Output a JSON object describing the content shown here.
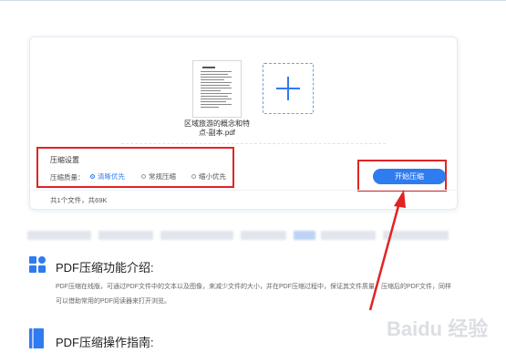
{
  "file": {
    "name": "区域旅游的概念和特点-副本.pdf"
  },
  "settings": {
    "title": "压缩设置",
    "quality_label": "压缩质量：",
    "options": [
      "清晰优先",
      "常规压缩",
      "缩小优先"
    ],
    "selected": "清晰优先"
  },
  "start_button": "开始压缩",
  "file_count": "共1个文件，共69K",
  "sections": [
    {
      "title": "PDF压缩功能介绍:",
      "body": "PDF压缩在线版，可通过PDF文件中的文本以及图像，来减少文件的大小，并在PDF压缩过程中，保证其文件质量。压缩后的PDF文件，同样可以借助常用的PDF阅读器来打开浏览。"
    },
    {
      "title": "PDF压缩操作指南:"
    }
  ],
  "colors": {
    "accent": "#2f7bf0",
    "highlight": "#e02424"
  },
  "watermark": "Baidu 经验"
}
